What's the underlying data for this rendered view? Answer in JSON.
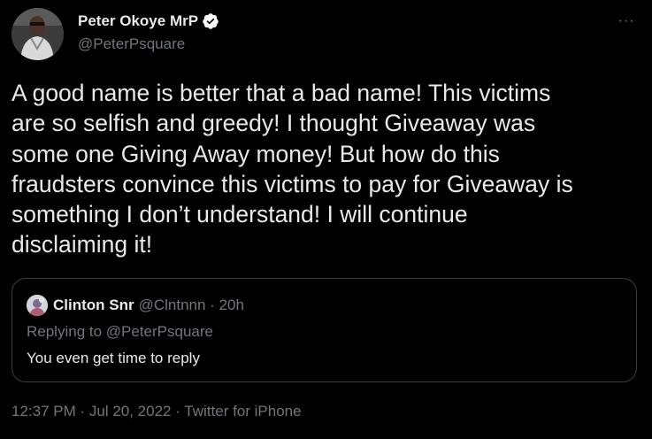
{
  "author": {
    "name": "Peter Okoye MrP",
    "handle": "@PeterPsquare",
    "verified": true
  },
  "more_label": "···",
  "tweet": {
    "text": "A good name is better that a bad name! This victims\nare so selfish and greedy! I thought Giveaway was\nsome one Giving Away money! But how do this\nfraudsters convince this victims to pay for Giveaway is\nsomething I don’t understand! I will continue\ndisclaiming it!"
  },
  "quote": {
    "name": "Clinton Snr",
    "meta": "@Clntnnn · 20h",
    "replying_to": "Replying to @PeterPsquare",
    "text": "You even get time to reply"
  },
  "footer": {
    "meta": "12:37 PM · Jul 20, 2022 · Twitter for iPhone"
  },
  "colors": {
    "background": "#000000",
    "text": "#e7e9ea",
    "secondary": "#71767b",
    "border": "#3a3d41",
    "verified_badge": "#ffffff"
  }
}
